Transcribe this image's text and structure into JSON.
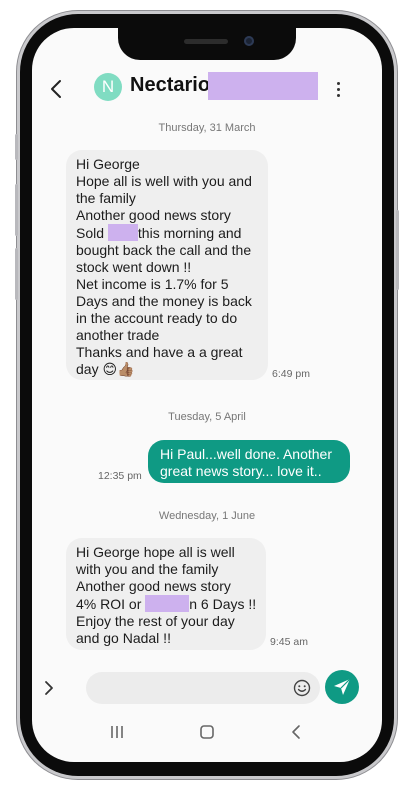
{
  "header": {
    "contact_name": "Nectarios",
    "avatar_letter": "N",
    "avatar_color": "#80dcc2",
    "back_icon": "chevron-left-icon",
    "menu_icon": "more-vertical-icon"
  },
  "messages": [
    {
      "date_separator": "Thursday, 31 March",
      "direction": "incoming",
      "lines": [
        "Hi George",
        "Hope all is well with you and",
        "the family",
        "Another good news story",
        "Sold",
        "this morning and",
        "bought back the call and the",
        "stock went down !!",
        "Net income is 1.7% for 5",
        "Days and the money is back",
        "in the account ready to do",
        "another trade",
        "Thanks and have a a great",
        "day 😊👍🏽"
      ],
      "time": "6:49 pm"
    },
    {
      "date_separator": "Tuesday, 5 April",
      "direction": "outgoing",
      "lines": [
        "Hi Paul...well done. Another",
        "great news story... love it.."
      ],
      "time": "12:35 pm"
    },
    {
      "date_separator": "Wednesday, 1 June",
      "direction": "incoming",
      "lines": [
        "Hi George hope all is well",
        "with you and the family",
        "Another good news story",
        "4% ROI or",
        "n 6 Days !!",
        "Enjoy the rest of your day",
        "and go Nadal !!"
      ],
      "time": "9:45 am"
    }
  ],
  "compose": {
    "expand_icon": "chevron-right-icon",
    "emoji_icon": "smiley-icon",
    "send_icon": "send-icon",
    "accent_color": "#0f9a84"
  },
  "navbar": {
    "recents_icon": "recents-icon",
    "home_icon": "home-icon",
    "back_icon": "back-icon"
  },
  "colors": {
    "redaction": "#cdb1ee",
    "incoming_bubble": "#efefef",
    "outgoing_bubble": "#0f9a84"
  }
}
